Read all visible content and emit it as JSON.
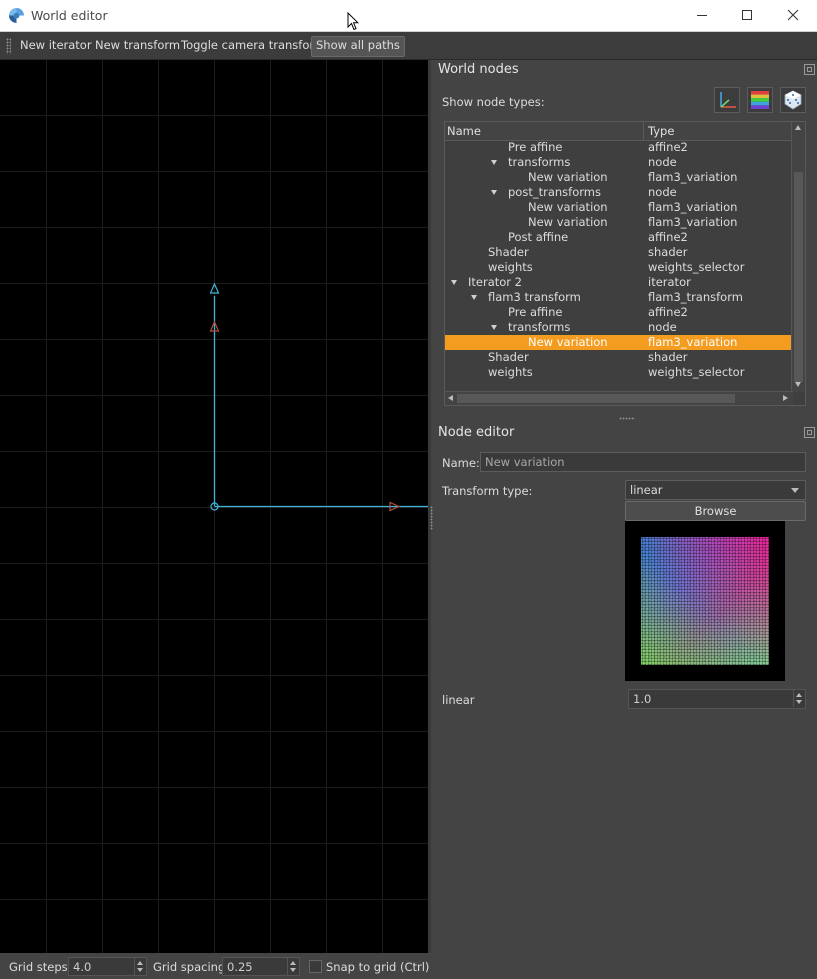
{
  "window": {
    "title": "World editor"
  },
  "toolbar": {
    "new_iterator": "New iterator",
    "new_transform": "New transform",
    "toggle_camera": "Toggle camera transform",
    "show_all_paths": "Show all paths"
  },
  "world_nodes": {
    "title": "World nodes",
    "show_node_types_label": "Show node types:",
    "type_icons": [
      "axes-icon",
      "gradient-icon",
      "dice-icon"
    ],
    "columns": {
      "name": "Name",
      "type": "Type"
    },
    "rows": [
      {
        "name": "Pre affine",
        "type": "affine2"
      },
      {
        "name": "transforms",
        "type": "node"
      },
      {
        "name": "New variation",
        "type": "flam3_variation"
      },
      {
        "name": "post_transforms",
        "type": "node"
      },
      {
        "name": "New variation",
        "type": "flam3_variation"
      },
      {
        "name": "New variation",
        "type": "flam3_variation"
      },
      {
        "name": "Post affine",
        "type": "affine2"
      },
      {
        "name": "Shader",
        "type": "shader"
      },
      {
        "name": "weights",
        "type": "weights_selector"
      },
      {
        "name": "Iterator 2",
        "type": "iterator"
      },
      {
        "name": "flam3 transform",
        "type": "flam3_transform"
      },
      {
        "name": "Pre affine",
        "type": "affine2"
      },
      {
        "name": "transforms",
        "type": "node"
      },
      {
        "name": "New variation",
        "type": "flam3_variation"
      },
      {
        "name": "Shader",
        "type": "shader"
      },
      {
        "name": "weights",
        "type": "weights_selector"
      }
    ],
    "selected_index": 13
  },
  "node_editor": {
    "title": "Node editor",
    "name_label": "Name:",
    "name_value": "New variation",
    "transform_type_label": "Transform type:",
    "transform_type_value": "linear",
    "browse_label": "Browse",
    "param_label": "linear",
    "param_value": "1.0"
  },
  "statusbar": {
    "grid_steps_label": "Grid steps:",
    "grid_steps_value": "4.0",
    "grid_spacing_label": "Grid spacing:",
    "grid_spacing_value": "0.25",
    "snap_label": "Snap to grid (Ctrl)",
    "snap_checked": false
  },
  "colors": {
    "selection": "#f39c1f",
    "axis_cyan": "#3fb5d8",
    "axis_red": "#b5503f",
    "panel_bg": "#444444"
  }
}
